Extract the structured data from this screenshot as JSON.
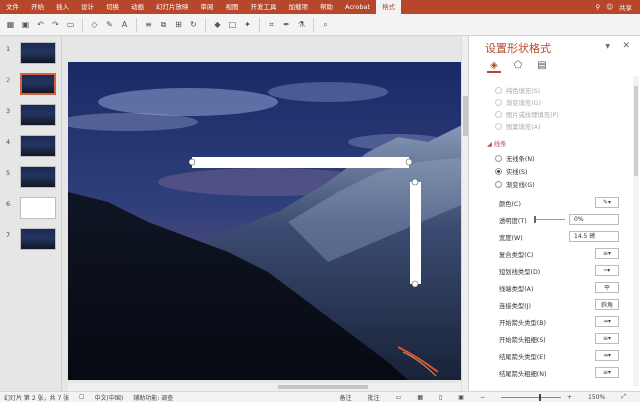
{
  "ribbon": {
    "tabs": [
      "文件",
      "开始",
      "插入",
      "设计",
      "切换",
      "动画",
      "幻灯片放映",
      "审阅",
      "视图",
      "开发工具",
      "加载项",
      "帮助",
      "Acrobat",
      "格式"
    ],
    "active_tab": "格式",
    "share_label": "共享"
  },
  "toolbar": {
    "icons": [
      "layout-icon",
      "save-icon",
      "undo-icon",
      "redo-icon",
      "slideshow-icon",
      "shape-icon",
      "format-painter-icon",
      "text-box-icon",
      "align-icon",
      "arrange-icon",
      "group-icon",
      "rotate-icon",
      "fill-icon",
      "outline-icon",
      "effects-icon",
      "crop-icon",
      "pen-icon",
      "eyedropper-icon",
      "search-icon"
    ]
  },
  "thumbnails": [
    {
      "num": "1",
      "blank": false,
      "selected": false
    },
    {
      "num": "2",
      "blank": false,
      "selected": true
    },
    {
      "num": "3",
      "blank": false,
      "selected": false
    },
    {
      "num": "4",
      "blank": false,
      "selected": false
    },
    {
      "num": "5",
      "blank": false,
      "selected": false
    },
    {
      "num": "6",
      "blank": true,
      "selected": false
    },
    {
      "num": "7",
      "blank": false,
      "selected": false
    }
  ],
  "pane": {
    "title": "设置形状格式",
    "fill_options": [
      "纯色填充(S)",
      "渐变填充(G)",
      "图片或纹理填充(P)",
      "图案填充(A)"
    ],
    "line_section": "线条",
    "line_options": [
      {
        "label": "无线条(N)",
        "on": false
      },
      {
        "label": "实线(S)",
        "on": true
      },
      {
        "label": "渐变线(G)",
        "on": false
      }
    ],
    "fields": {
      "color_label": "颜色(C)",
      "transparency_label": "透明度(T)",
      "transparency_value": "0%",
      "width_label": "宽度(W)",
      "width_value": "14.5 磅",
      "compound_label": "复合类型(C)",
      "dash_label": "短划线类型(D)",
      "cap_label": "线端类型(A)",
      "cap_value": "平",
      "join_label": "连接类型(J)",
      "join_value": "斜角",
      "begin_arrow_type_label": "开始箭头类型(B)",
      "begin_arrow_size_label": "开始箭头粗细(S)",
      "end_arrow_type_label": "结尾箭头类型(E)",
      "end_arrow_size_label": "结尾箭头粗细(N)"
    }
  },
  "status": {
    "slide_info": "幻灯片 第 2 张，共 7 张",
    "language": "中文(中国)",
    "accessibility": "辅助功能: 调查",
    "notes": "备注",
    "comments": "批注",
    "zoom": "150%"
  },
  "colors": {
    "accent": "#b7472a",
    "selection": "#d0633e",
    "shape_fill": "#ffffff"
  }
}
